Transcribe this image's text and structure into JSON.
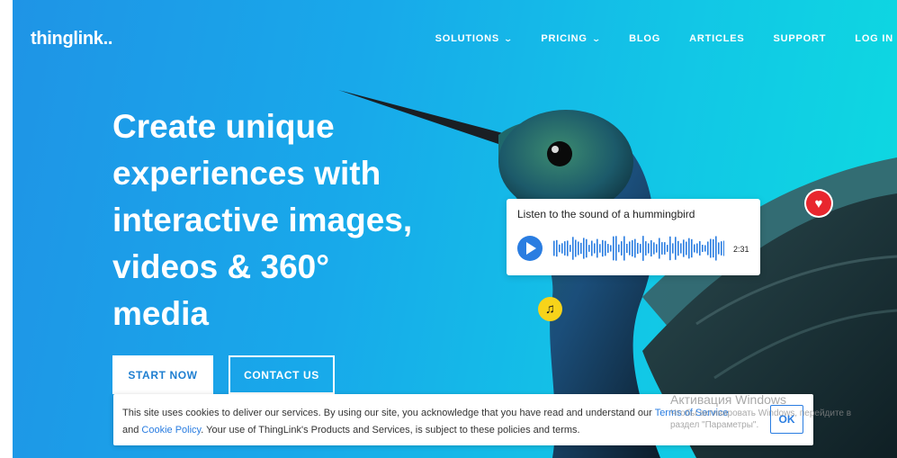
{
  "header": {
    "logo": "thinglink..",
    "nav": [
      {
        "label": "SOLUTIONS",
        "has_dropdown": true
      },
      {
        "label": "PRICING",
        "has_dropdown": true
      },
      {
        "label": "BLOG",
        "has_dropdown": false
      },
      {
        "label": "ARTICLES",
        "has_dropdown": false
      },
      {
        "label": "SUPPORT",
        "has_dropdown": false
      },
      {
        "label": "LOG IN",
        "has_dropdown": false
      }
    ]
  },
  "hero": {
    "headline_lines": [
      "Create unique",
      "experiences with",
      "interactive images,",
      "videos & 360°",
      "media"
    ],
    "start_label": "START NOW",
    "contact_label": "CONTACT US"
  },
  "audio": {
    "title": "Listen to the sound of a hummingbird",
    "duration": "2:31"
  },
  "cookie": {
    "text_1": "This site uses cookies to deliver our services. By using our site, you acknowledge that you have read and understand our ",
    "terms_link": "Terms of Service",
    "text_2": " and ",
    "cookie_link": "Cookie Policy",
    "text_3": ". Your use of ThingLink's Products and Services, is subject to these policies and terms.",
    "ok_label": "OK"
  },
  "watermark": {
    "line1": "Активация Windows",
    "line2": "Чтобы активировать Windows, перейдите в",
    "line3": "раздел \"Параметры\"."
  },
  "colors": {
    "accent": "#2a7de1",
    "heart": "#e8262e",
    "music": "#f7d31a"
  },
  "icons": {
    "heart": "heart-icon",
    "music": "music-note-icon",
    "play": "play-icon",
    "chevron": "chevron-down-icon"
  }
}
